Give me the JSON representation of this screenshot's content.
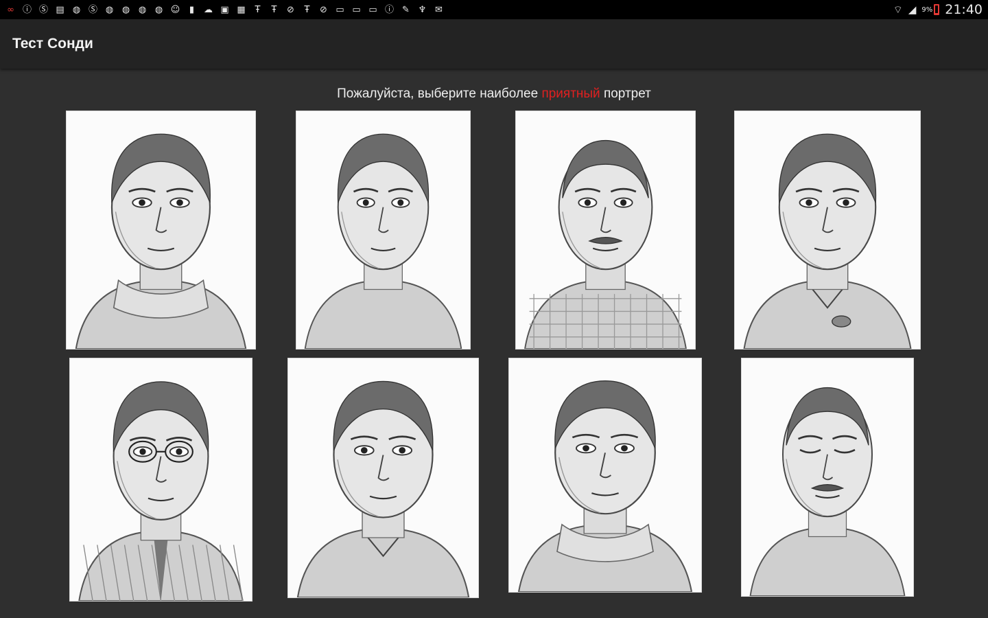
{
  "status_bar": {
    "notification_icons": [
      {
        "name": "voicemail-icon",
        "glyph": "∞",
        "color": "#e53935"
      },
      {
        "name": "info-icon",
        "glyph": "ⓘ"
      },
      {
        "name": "skype-icon",
        "glyph": "Ⓢ"
      },
      {
        "name": "book-icon",
        "glyph": "▤"
      },
      {
        "name": "circle-icon",
        "glyph": "◍"
      },
      {
        "name": "skype-icon",
        "glyph": "Ⓢ"
      },
      {
        "name": "circle-icon",
        "glyph": "◍"
      },
      {
        "name": "circle-icon",
        "glyph": "◍"
      },
      {
        "name": "circle-icon",
        "glyph": "◍"
      },
      {
        "name": "circle-icon",
        "glyph": "◍"
      },
      {
        "name": "face-icon",
        "glyph": "☺"
      },
      {
        "name": "clipboard-icon",
        "glyph": "▮"
      },
      {
        "name": "cloud-icon",
        "glyph": "☁"
      },
      {
        "name": "note-icon",
        "glyph": "▣"
      },
      {
        "name": "calendar-icon",
        "glyph": "▦"
      },
      {
        "name": "newspaper-icon",
        "glyph": "Ŧ"
      },
      {
        "name": "newspaper-icon",
        "glyph": "Ŧ"
      },
      {
        "name": "blocked-icon",
        "glyph": "⊘"
      },
      {
        "name": "newspaper-icon",
        "glyph": "Ŧ"
      },
      {
        "name": "blocked-icon",
        "glyph": "⊘"
      },
      {
        "name": "chat-icon",
        "glyph": "▭"
      },
      {
        "name": "chat-icon",
        "glyph": "▭"
      },
      {
        "name": "chat-icon",
        "glyph": "▭"
      },
      {
        "name": "info-icon",
        "glyph": "ⓘ"
      },
      {
        "name": "wrench-icon",
        "glyph": "✎"
      },
      {
        "name": "usb-icon",
        "glyph": "♆"
      },
      {
        "name": "mail-icon",
        "glyph": "✉"
      }
    ],
    "wifi_icon": "wifi-icon",
    "signal_icon": "signal-icon",
    "battery_percent": "9%",
    "battery_level": 0.09,
    "battery_color": "#e53935",
    "time": "21:40"
  },
  "action_bar": {
    "title": "Тест Сонди"
  },
  "prompt": {
    "before": "Пожалуйста, выберите наиболее ",
    "highlight": "приятный",
    "after": " портрет",
    "highlight_color": "#e02020"
  },
  "portraits": [
    {
      "name": "portrait-woman-scarf",
      "subject": "woman",
      "hair": "center-parted short",
      "clothing": "knit scarf",
      "eyes": "open"
    },
    {
      "name": "portrait-bare-shoulders-man",
      "subject": "man",
      "hair": "swept back",
      "clothing": "bare shoulders",
      "eyes": "open"
    },
    {
      "name": "portrait-mustache-plaid-man",
      "subject": "man",
      "hair": "receding",
      "clothing": "plaid shirt",
      "eyes": "open",
      "mustache": true
    },
    {
      "name": "portrait-woman-brooch",
      "subject": "woman",
      "hair": "pulled back",
      "clothing": "fur collar with brooch",
      "eyes": "open"
    },
    {
      "name": "portrait-glasses-suit-man",
      "subject": "man",
      "hair": "short",
      "clothing": "striped suit and tie",
      "eyes": "open",
      "glasses": true
    },
    {
      "name": "portrait-collar-man",
      "subject": "man",
      "hair": "swept back",
      "clothing": "jacket and collar shirt",
      "eyes": "open"
    },
    {
      "name": "portrait-smiling-woman-scarf",
      "subject": "woman",
      "hair": "pulled back",
      "clothing": "scarf",
      "eyes": "open"
    },
    {
      "name": "portrait-eyes-closed-mustache-man",
      "subject": "man",
      "hair": "balding",
      "clothing": "shirt",
      "eyes": "closed",
      "mustache": true
    }
  ]
}
